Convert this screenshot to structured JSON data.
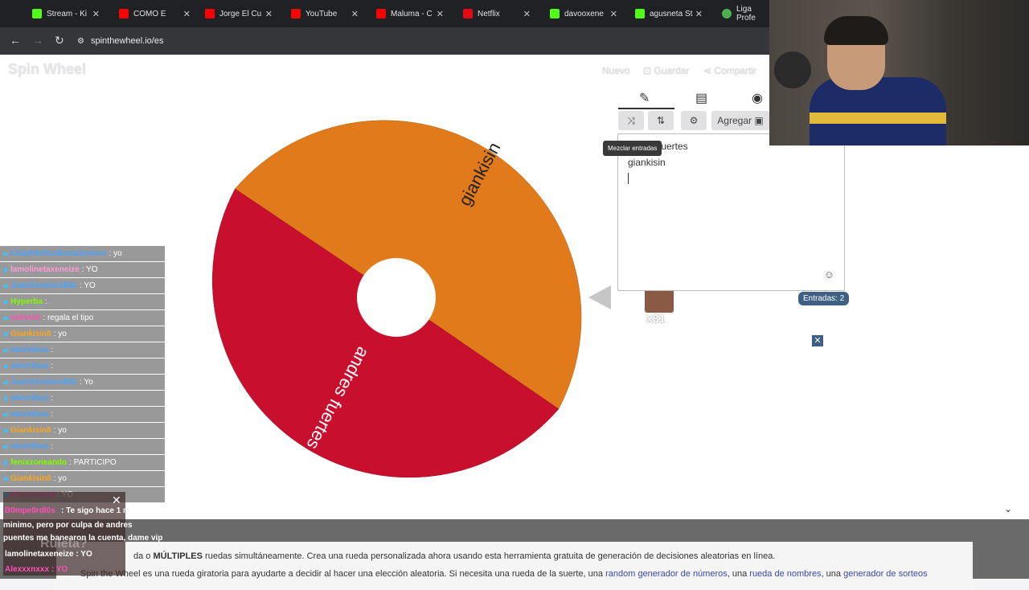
{
  "tabs": [
    {
      "label": "Stream - Ki",
      "color": "#53fc18"
    },
    {
      "label": "COMO E",
      "color": "#ff0000"
    },
    {
      "label": "Jorge El Cu",
      "color": "#ff0000"
    },
    {
      "label": "YouTube",
      "color": "#ff0000"
    },
    {
      "label": "Maluma - C",
      "color": "#ff0000"
    },
    {
      "label": "Netflix",
      "color": "#e50914"
    },
    {
      "label": "davooxene",
      "color": "#53fc18"
    },
    {
      "label": "agusneta St",
      "color": "#53fc18"
    },
    {
      "label": "Liga Profe",
      "color": "#4caf50"
    }
  ],
  "address": {
    "url": "spinthewheel.io/es"
  },
  "site": {
    "logo": "Spin Wheel",
    "nav": {
      "new": "Nuevo",
      "save": "Guardar",
      "share": "Compartir"
    }
  },
  "wheel": {
    "segments": [
      {
        "label": "giankisin",
        "color": "#e07a1a"
      },
      {
        "label": "andres fuertes",
        "color": "#c8102e"
      }
    ]
  },
  "editor": {
    "tooltip": "Mezclar entradas",
    "add_label": "Agregar",
    "entries": [
      "andres fuertes",
      "giankisin"
    ],
    "entries_visible": [
      "fuertes",
      "giankisin"
    ],
    "count_label": "Entradas: 2"
  },
  "emote": {
    "count": "x31"
  },
  "bottom": {
    "line1_pre": "da o ",
    "line1_bold": "MÚLTIPLES",
    "line1_post": " ruedas simultáneamente. Crea una rueda personalizada ahora usando esta herramienta gratuita de generación de decisiones aleatorias en línea.",
    "line2_pre": "Spin the Wheel es una rueda giratoria para ayudarte a decidir al hacer una elección aleatoria. Si necesita una rueda de la suerte, una ",
    "line2_link1": "random generador de números",
    "line2_mid": ", una ",
    "line2_link2": "rueda de nombres",
    "line2_end": ", una ",
    "line2_link3": "generador de sorteos"
  },
  "chat": [
    {
      "user": "ClubAtleticoBocaJuniors",
      "msg": ": yo",
      "color": "#4aa3ff"
    },
    {
      "user": "lamolinetaxeneize",
      "msg": ": YO",
      "color": "#ff9ad5"
    },
    {
      "user": "JuanXeneize1891",
      "msg": ": YO",
      "color": "#4aa3ff"
    },
    {
      "user": "Hyperba",
      "msg": ": ",
      "color": "#7cfc00"
    },
    {
      "user": "milivish",
      "msg": ": regala el tipo",
      "color": "#ff4fb8"
    },
    {
      "user": "Giankisin8",
      "msg": ": yo",
      "color": "#f5a623"
    },
    {
      "user": "stevinhuo",
      "msg": ": ",
      "color": "#4aa3ff"
    },
    {
      "user": "stevinhuo",
      "msg": ": ",
      "color": "#4aa3ff"
    },
    {
      "user": "JuanXeneize1891",
      "msg": ": Yo",
      "color": "#4aa3ff"
    },
    {
      "user": "stevinhuo",
      "msg": ": ",
      "color": "#4aa3ff"
    },
    {
      "user": "stevinhuo",
      "msg": ": ",
      "color": "#4aa3ff"
    },
    {
      "user": "Giankisin8",
      "msg": ": yo",
      "color": "#f5a623"
    },
    {
      "user": "stevinhuo",
      "msg": ": ",
      "color": "#4aa3ff"
    },
    {
      "user": "fenixzoneando",
      "msg": ": PARTICIPO",
      "color": "#7cfc00"
    },
    {
      "user": "Giankisin8",
      "msg": ": yo",
      "color": "#f5a623"
    },
    {
      "user": "Alexxxnxxx",
      "msg": ": YO",
      "color": "#ff4fb8"
    }
  ],
  "overlay": {
    "user": "B0mpe0rdl0s",
    "msg1": ": Te sigo hace 1 mes",
    "msg2": "minimo, pero por culpa de andres",
    "msg3": "puentes me banearon la cuenta, dame vip",
    "line4": "lamolinetaxeneize : YO",
    "line5": "Alexxxnxxx : YO",
    "title": "Ruleta?"
  }
}
